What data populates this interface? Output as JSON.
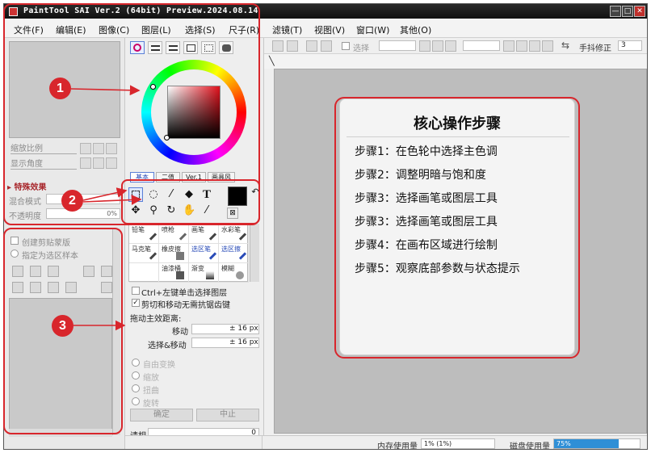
{
  "window": {
    "title": "PaintTool SAI Ver.2 (64bit) Preview.2024.08.14"
  },
  "menu": [
    "文件(F)",
    "编辑(E)",
    "图像(C)",
    "图层(L)",
    "选择(S)",
    "尺子(R)",
    "滤镜(T)",
    "视图(V)",
    "窗口(W)",
    "其他(O)"
  ],
  "navigator": {
    "zoom_label": "缩放比例",
    "angle_label": "显示角度"
  },
  "effects": {
    "header": "特殊效果",
    "blend_label": "混合模式",
    "opacity_label": "不透明度",
    "opacity_value": "0%",
    "clip_label": "创建剪贴蒙版",
    "selection_source_label": "指定为选区样本"
  },
  "color_modes": [
    "基本",
    "二值",
    "Ver.1",
    "画具风"
  ],
  "brushes": [
    {
      "name": "铅笔",
      "active": false
    },
    {
      "name": "喷枪",
      "active": false
    },
    {
      "name": "画笔",
      "active": false
    },
    {
      "name": "水彩笔",
      "active": false
    },
    {
      "name": "马克笔",
      "active": false
    },
    {
      "name": "橡皮擦",
      "active": false
    },
    {
      "name": "选区笔",
      "active": true
    },
    {
      "name": "选区擦",
      "active": true
    },
    {
      "name": "",
      "active": false
    },
    {
      "name": "油漆桶",
      "active": false
    },
    {
      "name": "渐变",
      "active": false
    },
    {
      "name": "模糊",
      "active": false
    }
  ],
  "options": {
    "ctrl_click": "Ctrl+左键单击选择图层",
    "no_aa": "剪切和移动无需抗锯齿键",
    "drag_label": "拖动主效距离:",
    "move_label": "移动",
    "move_value": "± 16 px",
    "select_move_label": "选择&移动",
    "select_move_value": "± 16 px",
    "transform": [
      "自由变换",
      "缩放",
      "扭曲",
      "旋转"
    ],
    "ok": "确定",
    "cancel": "中止",
    "zoom_label": "请相",
    "zoom_value": "0"
  },
  "toolbar": {
    "select_label": "选择",
    "stabilizer_label": "手抖修正",
    "stabilizer_value": "3"
  },
  "status": {
    "memory_label": "内存使用量",
    "memory_value": "1% (1%)",
    "disk_label": "磁盘使用量",
    "disk_value": "75%",
    "disk_fraction": 0.75
  },
  "guide": {
    "title": "核心操作步骤",
    "steps": [
      "步骤1：在色轮中选择主色调",
      "步骤2：调整明暗与饱和度",
      "步骤3：选择画笔或图层工具",
      "步骤3：选择画笔或图层工具",
      "步骤4：在画布区域进行绘制",
      "步骤5：观察底部参数与状态提示"
    ]
  },
  "callouts": [
    "1",
    "2",
    "3"
  ],
  "colors": {
    "annotation": "#d8262c",
    "accent": "#5a7fd6",
    "current_color": "#000000",
    "progress": "#2f8fd6"
  }
}
